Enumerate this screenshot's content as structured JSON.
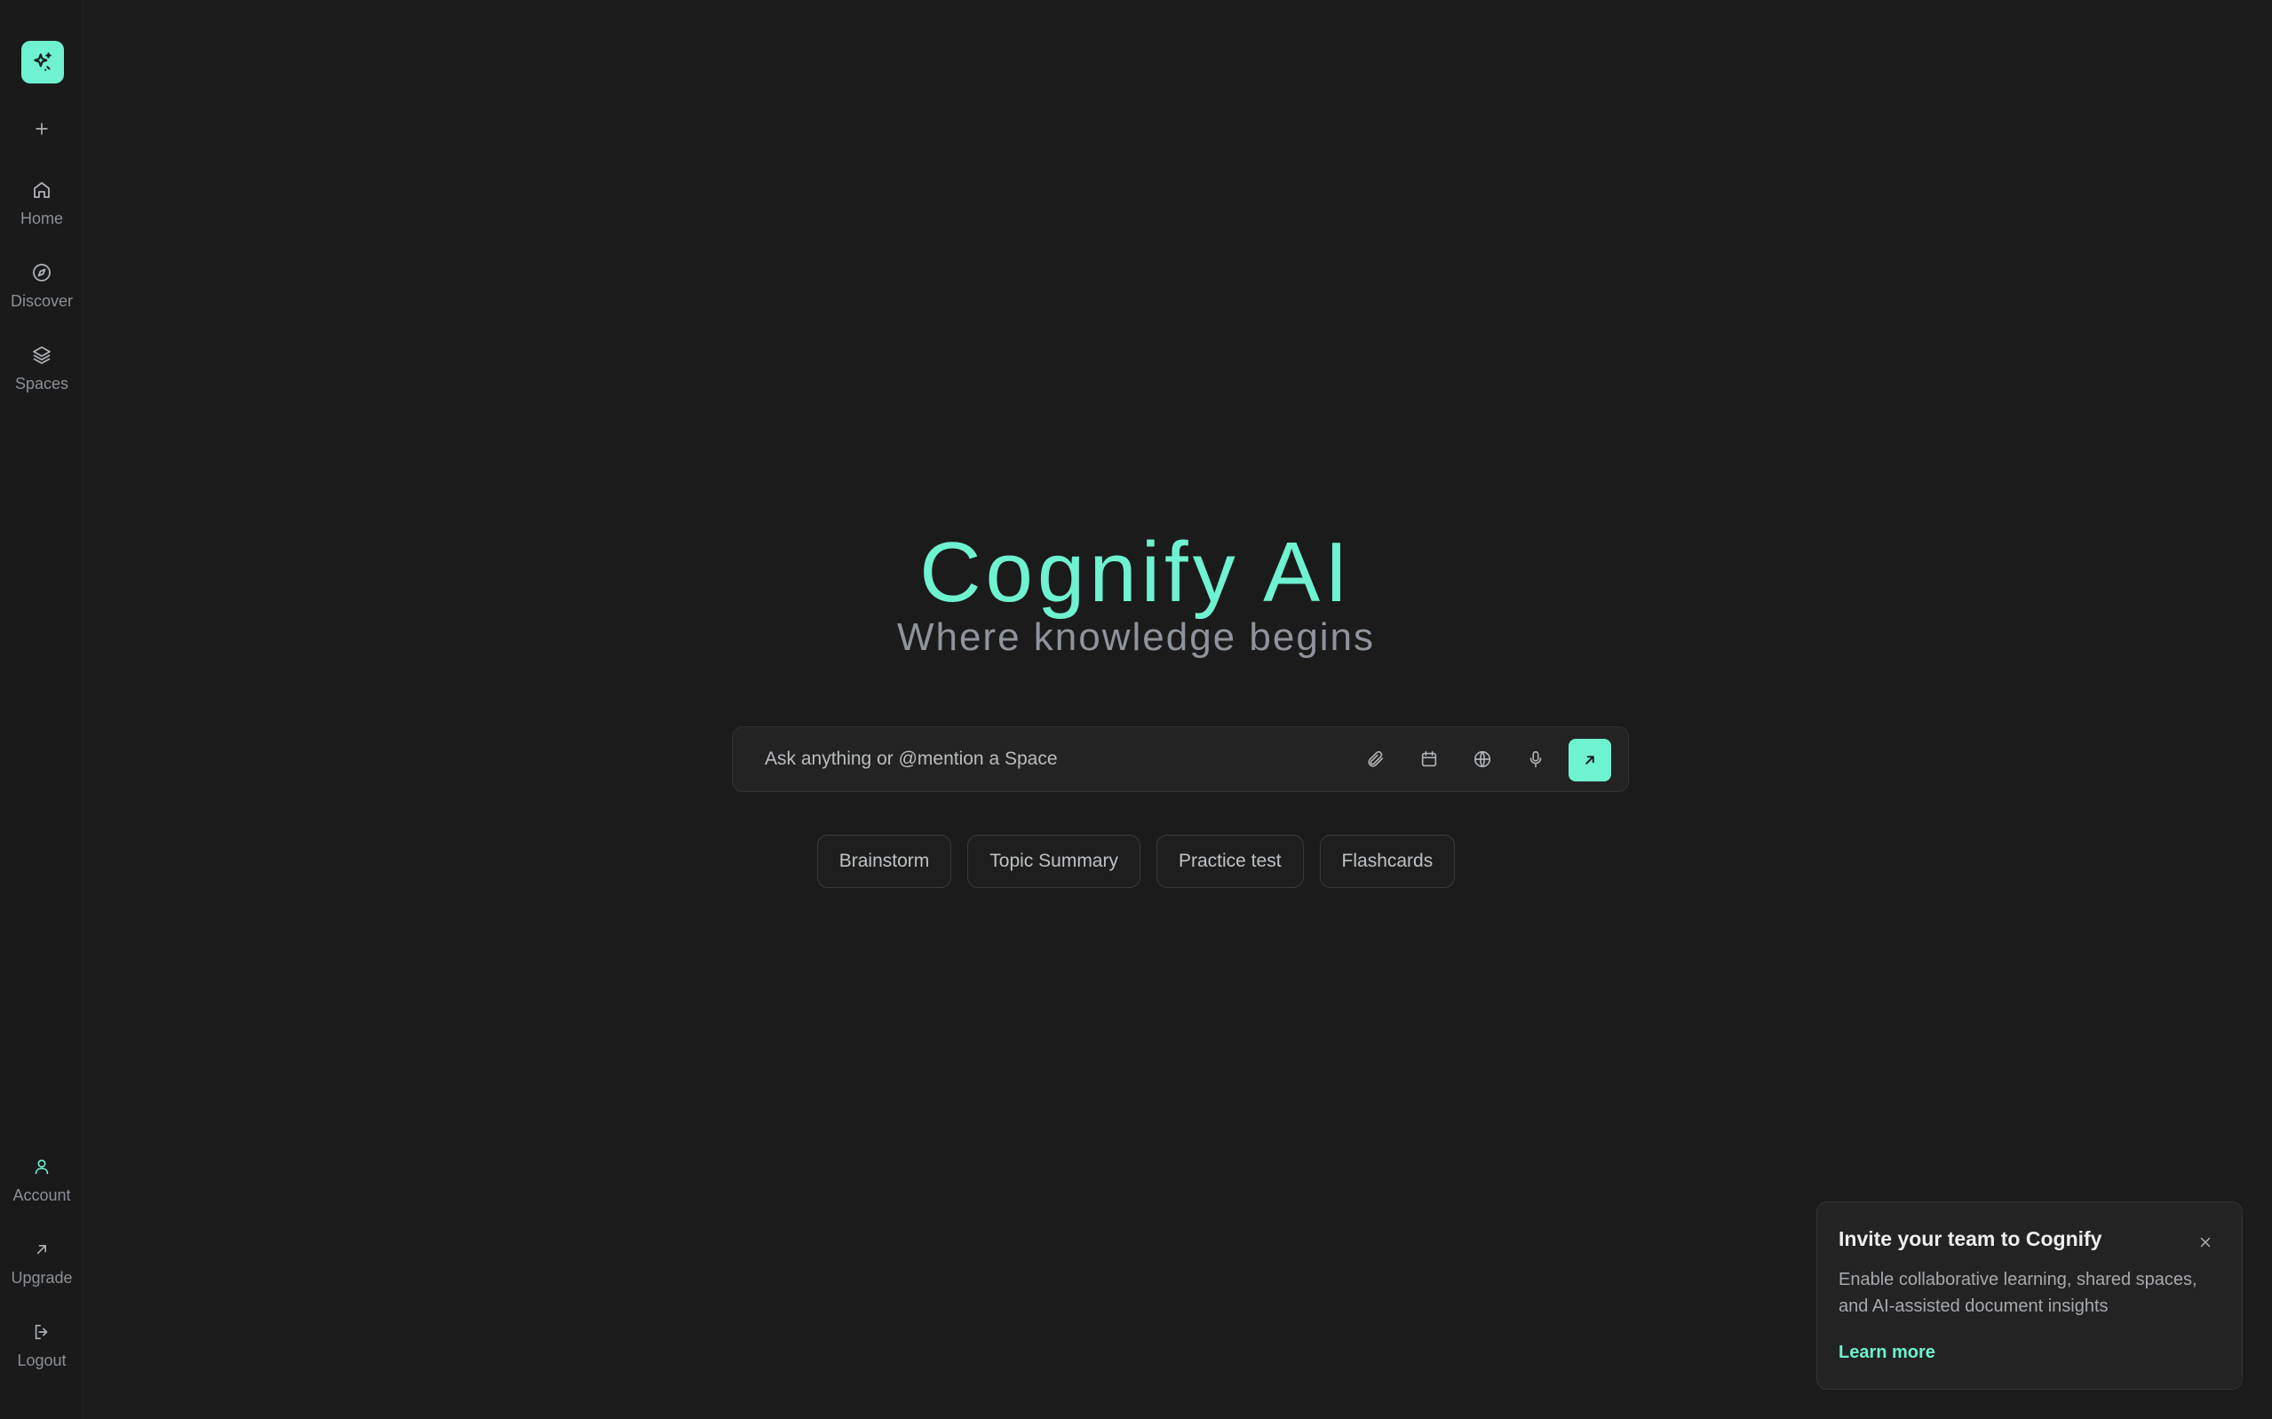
{
  "app": {
    "title": "Cognify AI",
    "tagline": "Where knowledge begins"
  },
  "sidebar": {
    "logo_icon": "sparkle-icon",
    "new_icon": "plus-icon",
    "items": [
      {
        "label": "Home",
        "icon": "home-icon"
      },
      {
        "label": "Discover",
        "icon": "compass-icon"
      },
      {
        "label": "Spaces",
        "icon": "layers-icon"
      }
    ],
    "bottom_items": [
      {
        "label": "Account",
        "icon": "user-icon"
      },
      {
        "label": "Upgrade",
        "icon": "arrow-up-right-icon"
      },
      {
        "label": "Logout",
        "icon": "logout-icon"
      }
    ]
  },
  "search": {
    "placeholder": "Ask anything or @mention a Space",
    "value": "",
    "tools": [
      "paperclip-icon",
      "calendar-icon",
      "globe-icon",
      "microphone-icon"
    ],
    "send_icon": "arrow-up-right-icon"
  },
  "suggestions": [
    "Brainstorm",
    "Topic Summary",
    "Practice test",
    "Flashcards"
  ],
  "toast": {
    "title": "Invite your team to Cognify",
    "body": "Enable collaborative learning, shared spaces, and AI-assisted document insights",
    "link": "Learn more",
    "close_icon": "close-icon"
  },
  "colors": {
    "accent": "#6ef2cf",
    "background": "#1b1b1b",
    "panel": "#232323"
  }
}
